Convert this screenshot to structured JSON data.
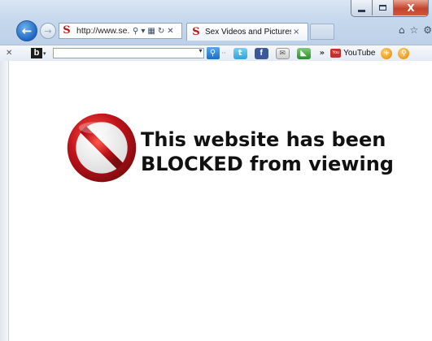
{
  "address_bar": {
    "url": "http://www.se...",
    "icons": [
      "search-icon",
      "dropdown-arrow-icon",
      "compat-view-icon",
      "refresh-icon",
      "stop-icon"
    ]
  },
  "tab": {
    "title": "Sex Videos and Pictures | Se...",
    "close_label": "×",
    "favicon_letter": "S"
  },
  "window_controls": {
    "close_label": "X"
  },
  "toolbar": {
    "logo_letter": "b",
    "more_label": "»",
    "youtube_label": "YouTube",
    "youtube_icon_text": "You Tube"
  },
  "message": {
    "line1": "This website has been",
    "line2": "BLOCKED from viewing"
  },
  "colors": {
    "block_red": "#c0121a",
    "chrome_blue": "#c6d8ed"
  }
}
